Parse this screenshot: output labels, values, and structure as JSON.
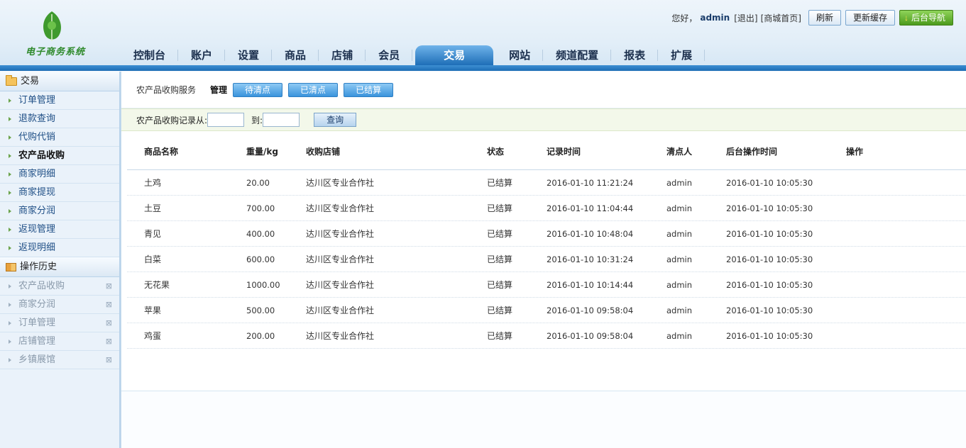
{
  "header": {
    "logo_text": "电子商务系统",
    "greeting": "您好，",
    "username": "admin",
    "logout_label": "[退出]",
    "shop_home_label": "[商城首页]",
    "refresh_label": "刷新",
    "update_cache_label": "更新缓存",
    "backend_nav_label": "后台导航"
  },
  "nav": {
    "tabs": [
      {
        "label": "控制台"
      },
      {
        "label": "账户"
      },
      {
        "label": "设置"
      },
      {
        "label": "商品"
      },
      {
        "label": "店铺"
      },
      {
        "label": "会员"
      },
      {
        "label": "交易"
      },
      {
        "label": "网站"
      },
      {
        "label": "频道配置"
      },
      {
        "label": "报表"
      },
      {
        "label": "扩展"
      }
    ],
    "active": "交易"
  },
  "sidebar": {
    "section_title": "交易",
    "items": [
      {
        "label": "订单管理"
      },
      {
        "label": "退款查询"
      },
      {
        "label": "代购代销"
      },
      {
        "label": "农产品收购"
      },
      {
        "label": "商家明细"
      },
      {
        "label": "商家提现"
      },
      {
        "label": "商家分润"
      },
      {
        "label": "返现管理"
      },
      {
        "label": "返现明细"
      }
    ],
    "history_title": "操作历史",
    "history": [
      {
        "label": "农产品收购"
      },
      {
        "label": "商家分润"
      },
      {
        "label": "订单管理"
      },
      {
        "label": "店铺管理"
      },
      {
        "label": "乡镇展馆"
      }
    ]
  },
  "toolbar": {
    "service_label": "农产品收购服务",
    "manage_label": "管理",
    "pending_label": "待清点",
    "counted_label": "已清点",
    "settled_label": "已结算"
  },
  "query": {
    "from_label": "农产品收购记录从:",
    "to_label": "到:",
    "from_value": "",
    "to_value": "",
    "search_label": "查询"
  },
  "table": {
    "headers": {
      "name": "商品名称",
      "weight": "重量",
      "weight_unit": "/kg",
      "shop": "收购店铺",
      "status": "状态",
      "record_time": "记录时间",
      "counter": "清点人",
      "op_time": "后台操作时间",
      "action": "操作"
    },
    "rows": [
      {
        "name": "土鸡",
        "weight": "20.00",
        "shop": "达川区专业合作社",
        "status": "已结算",
        "record_time": "2016-01-10 11:21:24",
        "counter": "admin",
        "op_time": "2016-01-10 10:05:30",
        "action": ""
      },
      {
        "name": "土豆",
        "weight": "700.00",
        "shop": "达川区专业合作社",
        "status": "已结算",
        "record_time": "2016-01-10 11:04:44",
        "counter": "admin",
        "op_time": "2016-01-10 10:05:30",
        "action": ""
      },
      {
        "name": "青见",
        "weight": "400.00",
        "shop": "达川区专业合作社",
        "status": "已结算",
        "record_time": "2016-01-10 10:48:04",
        "counter": "admin",
        "op_time": "2016-01-10 10:05:30",
        "action": ""
      },
      {
        "name": "白菜",
        "weight": "600.00",
        "shop": "达川区专业合作社",
        "status": "已结算",
        "record_time": "2016-01-10 10:31:24",
        "counter": "admin",
        "op_time": "2016-01-10 10:05:30",
        "action": ""
      },
      {
        "name": "无花果",
        "weight": "1000.00",
        "shop": "达川区专业合作社",
        "status": "已结算",
        "record_time": "2016-01-10 10:14:44",
        "counter": "admin",
        "op_time": "2016-01-10 10:05:30",
        "action": ""
      },
      {
        "name": "苹果",
        "weight": "500.00",
        "shop": "达川区专业合作社",
        "status": "已结算",
        "record_time": "2016-01-10 09:58:04",
        "counter": "admin",
        "op_time": "2016-01-10 10:05:30",
        "action": ""
      },
      {
        "name": "鸡蛋",
        "weight": "200.00",
        "shop": "达川区专业合作社",
        "status": "已结算",
        "record_time": "2016-01-10 09:58:04",
        "counter": "admin",
        "op_time": "2016-01-10 10:05:30",
        "action": ""
      }
    ]
  },
  "colors": {
    "nav_active": "#1e6eb7",
    "filter_button": "#3a93dc",
    "logo_green": "#2f8a2c"
  }
}
